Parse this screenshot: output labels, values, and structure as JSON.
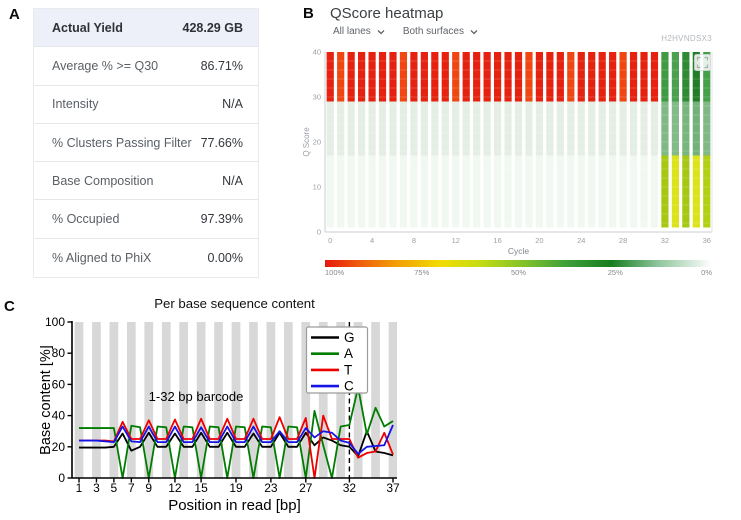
{
  "figure": {
    "panel_a_label": "A",
    "panel_b_label": "B",
    "panel_c_label": "C"
  },
  "metrics_table": {
    "rows": [
      {
        "label": "Actual Yield",
        "value": "428.29 GB",
        "highlight": true
      },
      {
        "label": "Average % >= Q30",
        "value": "86.71%",
        "highlight": false
      },
      {
        "label": "Intensity",
        "value": "N/A",
        "highlight": false
      },
      {
        "label": "% Clusters Passing Filter",
        "value": "77.66%",
        "highlight": false
      },
      {
        "label": "Base Composition",
        "value": "N/A",
        "highlight": false
      },
      {
        "label": "% Occupied",
        "value": "97.39%",
        "highlight": false
      },
      {
        "label": "% Aligned to PhiX",
        "value": "0.00%",
        "highlight": false
      }
    ]
  },
  "qscore_panel": {
    "title": "QScore heatmap",
    "filters": [
      {
        "label": "All lanes",
        "icon": "chevron-down-icon"
      },
      {
        "label": "Both surfaces",
        "icon": "chevron-down-icon"
      }
    ],
    "run_id": "H2HVNDSX3"
  },
  "chart_data": [
    {
      "type": "heatmap",
      "panel": "B",
      "title": "QScore heatmap",
      "xlabel": "Cycle",
      "ylabel": "Q Score",
      "xlim": [
        0,
        37
      ],
      "ylim": [
        0,
        40
      ],
      "xticks": [
        0,
        4,
        8,
        12,
        16,
        20,
        24,
        28,
        32,
        36
      ],
      "yticks": [
        0,
        10,
        20,
        30,
        40
      ],
      "n_cycles": 37,
      "read_cycles": {
        "cycle_range": [
          0,
          31
        ],
        "bands": [
          {
            "q_range": [
              29,
              40
            ],
            "color": "#e6210f"
          },
          {
            "q_range": [
              17,
              29
            ],
            "color": "#e4eee4"
          },
          {
            "q_range": [
              1,
              17
            ],
            "color": "#f1f7f1"
          }
        ]
      },
      "index_cycles": {
        "cycle_range": [
          32,
          36
        ],
        "bands": [
          {
            "q_range": [
              29,
              40
            ],
            "colors": [
              "#3f9a44",
              "#4aa04e",
              "#2e8a33",
              "#227d28",
              "#45a04a"
            ]
          },
          {
            "q_range": [
              17,
              29
            ],
            "colors": [
              "#7fb984",
              "#82bb87",
              "#79b57e",
              "#74b17a",
              "#7fb984"
            ]
          },
          {
            "q_range": [
              1,
              17
            ],
            "colors": [
              "#a6c813",
              "#dde31a",
              "#a6c813",
              "#dde31a",
              "#b2cf14"
            ]
          }
        ]
      },
      "orange_red_cycles": [
        1,
        7,
        12,
        19,
        23,
        28
      ],
      "orange_red_color": "#ef4612",
      "colorbar": {
        "labels": [
          "100%",
          "75%",
          "50%",
          "25%",
          "0%"
        ],
        "stops": [
          {
            "offset": 0,
            "color": "#e6180f"
          },
          {
            "offset": 0.08,
            "color": "#ee560c"
          },
          {
            "offset": 0.18,
            "color": "#f29c06"
          },
          {
            "offset": 0.3,
            "color": "#f2dc04"
          },
          {
            "offset": 0.4,
            "color": "#c5dc12"
          },
          {
            "offset": 0.52,
            "color": "#7fc02c"
          },
          {
            "offset": 0.62,
            "color": "#3fa139"
          },
          {
            "offset": 0.74,
            "color": "#177d20"
          },
          {
            "offset": 0.86,
            "color": "#8ec59b"
          },
          {
            "offset": 1,
            "color": "#ffffff"
          }
        ]
      }
    },
    {
      "type": "line",
      "panel": "C",
      "title": "Per base sequence content",
      "xlabel": "Position in read [bp]",
      "ylabel": "Base content [%]",
      "xlim": [
        0.5,
        37.5
      ],
      "ylim": [
        0,
        100
      ],
      "xticks": [
        1,
        3,
        5,
        7,
        9,
        12,
        15,
        19,
        23,
        27,
        32,
        37
      ],
      "yticks": [
        0,
        20,
        40,
        60,
        80,
        100
      ],
      "n_positions": 37,
      "annotation": "1-32 bp barcode",
      "dashed_line_x": 32,
      "background_stripes": "gray at odd positions",
      "legend_position": "upper right",
      "series": [
        {
          "name": "G",
          "color": "#000000",
          "values": [
            19.5,
            19.5,
            19.5,
            19.5,
            20,
            28.5,
            17.5,
            20,
            29,
            20,
            20,
            28.5,
            20,
            20,
            29,
            20,
            20,
            29,
            20,
            20,
            28.5,
            20,
            20,
            29,
            20,
            20,
            29,
            21,
            26,
            24,
            21,
            20,
            14,
            30,
            17,
            16,
            14.5
          ]
        },
        {
          "name": "A",
          "color": "#007d00",
          "values": [
            32,
            32,
            32,
            32,
            32,
            0,
            33.5,
            32.5,
            0,
            33,
            32.5,
            0,
            33,
            32.5,
            0,
            33,
            32.5,
            0,
            33,
            32.5,
            0,
            33,
            32.5,
            0,
            33,
            32.5,
            0,
            43,
            21,
            0,
            33,
            34,
            58,
            28,
            45,
            33,
            36.5
          ]
        },
        {
          "name": "T",
          "color": "#ee0000",
          "values": [
            24,
            24,
            24,
            24,
            23.5,
            36,
            25,
            25,
            37,
            25,
            25,
            37.5,
            25,
            25,
            38,
            25,
            25,
            38,
            25,
            25,
            38,
            25,
            25,
            39,
            25,
            25,
            38.5,
            0,
            40,
            25,
            25,
            25,
            13,
            16,
            17,
            29,
            15
          ]
        },
        {
          "name": "C",
          "color": "#1414e6",
          "values": [
            24,
            24,
            24,
            23.5,
            23,
            33,
            23.5,
            23,
            33,
            23,
            23,
            33,
            23,
            23,
            32.5,
            23,
            23,
            33,
            23,
            23,
            33,
            23,
            23,
            30,
            23,
            23,
            32,
            26,
            30,
            29,
            24,
            22.5,
            15.5,
            20,
            20.5,
            21,
            34
          ]
        }
      ]
    }
  ]
}
